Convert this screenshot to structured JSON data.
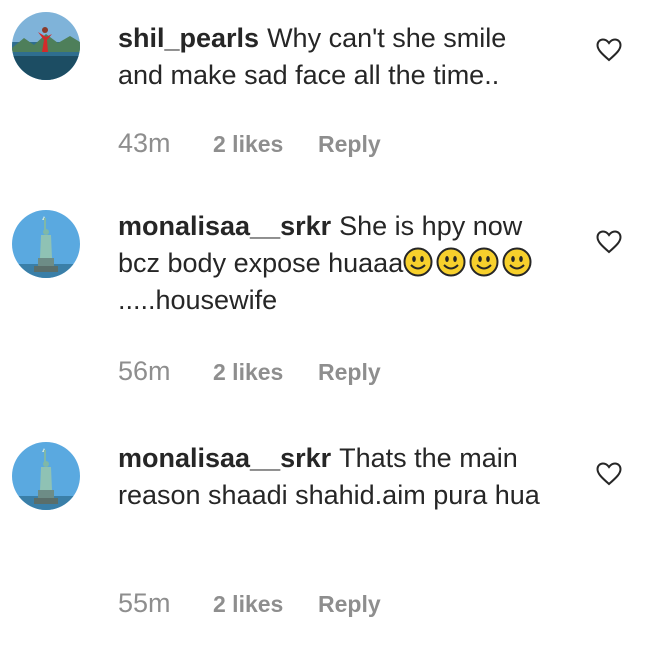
{
  "comments": [
    {
      "username": "shil_pearls",
      "text": "Why can't she smile and make sad face all the time..",
      "time": "43m",
      "likes": "2 likes",
      "reply": "Reply",
      "avatar_icon": "avatar-landscape-photo"
    },
    {
      "username": "monalisaa__srkr",
      "text_before": "She is hpy now bcz body expose huaaa",
      "text_after": ".....housewife",
      "emoji_icon": "smiley-face-icon",
      "time": "56m",
      "likes": "2 likes",
      "reply": "Reply",
      "avatar_icon": "avatar-statue-of-liberty"
    },
    {
      "username": "monalisaa__srkr",
      "text": "Thats the main reason shaadi shahid.aim pura hua",
      "time": "55m",
      "likes": "2 likes",
      "reply": "Reply",
      "avatar_icon": "avatar-statue-of-liberty"
    }
  ],
  "icons": {
    "like": "heart-outline-icon"
  },
  "colors": {
    "text": "#262626",
    "meta": "#8e8e8e",
    "emoji": "#f7d02c"
  }
}
